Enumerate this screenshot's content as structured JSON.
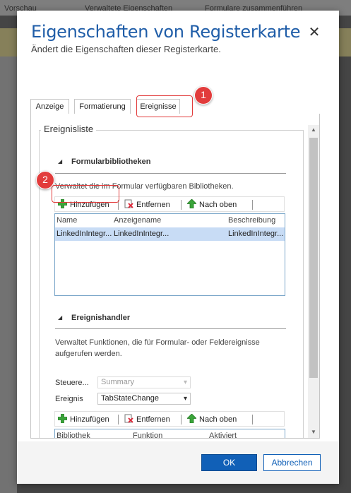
{
  "background": {
    "toolbar_items": [
      "Vorschau",
      "Verwaltete Eigenschaften",
      "Formulare zusammenführen"
    ]
  },
  "dialog": {
    "title": "Eigenschaften von Registerkarte",
    "subtitle": "Ändert die Eigenschaften dieser Registerkarte.",
    "close_glyph": "✕"
  },
  "tabs": [
    {
      "label": "Anzeige",
      "active": false
    },
    {
      "label": "Formatierung",
      "active": false
    },
    {
      "label": "Ereignisse",
      "active": true
    }
  ],
  "event_list": {
    "legend": "Ereignisliste",
    "libraries": {
      "heading": "Formularbibliotheken",
      "description": "Verwaltet die im Formular verfügbaren Bibliotheken.",
      "toolbar": {
        "add": "Hinzufügen",
        "remove": "Entfernen",
        "up": "Nach oben"
      },
      "columns": [
        "Name",
        "Anzeigename",
        "Beschreibung"
      ],
      "rows": [
        {
          "name": "LinkedInIntegr...",
          "display_name": "LinkedInIntegr...",
          "description": "LinkedInIntegr..."
        }
      ]
    },
    "handlers": {
      "heading": "Ereignishandler",
      "description_line1": "Verwaltet Funktionen, die für Formular- oder Feldereignisse",
      "description_line2": "aufgerufen werden.",
      "control_label": "Steuere...",
      "control_value": "Summary",
      "event_label": "Ereignis",
      "event_value": "TabStateChange",
      "toolbar": {
        "add": "Hinzufügen",
        "remove": "Entfernen",
        "up": "Nach oben"
      },
      "columns": [
        "Bibliothek",
        "Funktion",
        "Aktiviert"
      ]
    }
  },
  "footer": {
    "ok": "OK",
    "cancel": "Abbrechen"
  },
  "callouts": [
    "1",
    "2"
  ],
  "colors": {
    "title_blue": "#1f5da8",
    "primary_button": "#1160b7",
    "selection_row": "#c8dcf5",
    "callout_red": "#e23c3c"
  }
}
